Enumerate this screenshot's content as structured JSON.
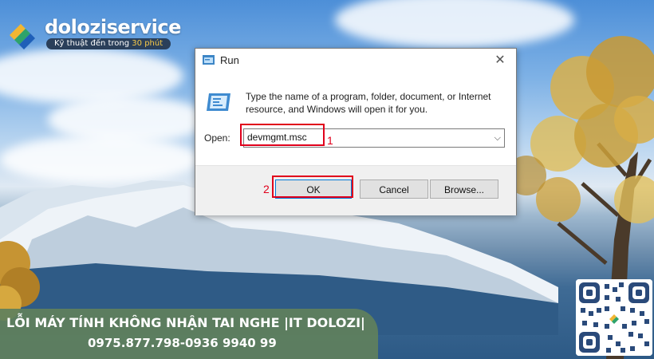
{
  "brand": {
    "name": "doloziservice",
    "tagline_prefix": "Kỹ thuật đến trong ",
    "tagline_highlight": "30 phút"
  },
  "dialog": {
    "title": "Run",
    "close_symbol": "✕",
    "instruction": "Type the name of a program, folder, document, or Internet resource, and Windows will open it for you.",
    "open_label": "Open:",
    "open_value": "devmgmt.msc",
    "dropdown_symbol": "⌵",
    "buttons": {
      "ok": "OK",
      "cancel": "Cancel",
      "browse": "Browse..."
    }
  },
  "annotations": {
    "step1": "1",
    "step2": "2",
    "color": "#e0001b"
  },
  "banner": {
    "title": "LỖI MÁY TÍNH KHÔNG NHẬN TAI NGHE |IT DOLOZI|",
    "phone": "0975.877.798-0936 9940 99"
  },
  "colors": {
    "banner_bg": "#60805c",
    "dialog_bg": "#ffffff",
    "button_bar": "#f0f0f0",
    "ok_border": "#0078d7"
  },
  "icons": {
    "title": "run-icon",
    "dialog": "run-icon",
    "logo": "dolozi-logo",
    "qr": "qr-code"
  }
}
